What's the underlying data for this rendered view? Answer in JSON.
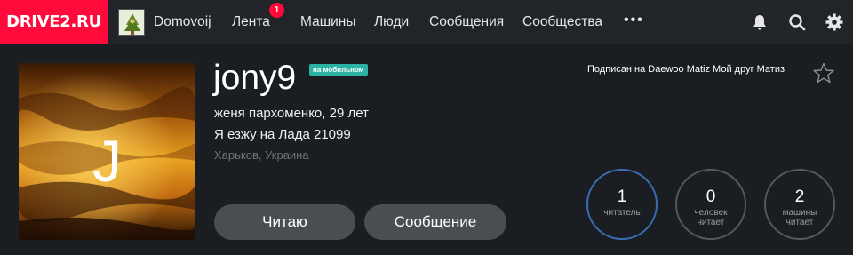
{
  "nav": {
    "logo": "DRIVE2.RU",
    "username": "Domovoij",
    "feed": "Лента",
    "feed_badge": "1",
    "cars": "Машины",
    "people": "Люди",
    "messages": "Сообщения",
    "communities": "Сообщества",
    "more": "•••",
    "icons": [
      "bell-icon",
      "search-icon",
      "gear-icon"
    ]
  },
  "profile": {
    "avatar_letter": "J",
    "username": "jony9",
    "mobile_badge": "на мобильном",
    "name_age": "женя пархоменко, 29 лет",
    "drives": "Я езжу на Лада 21099",
    "location": "Харьков, Украина",
    "subscribed": "Подписан на Daewoo Matiz Мой друг Матиз"
  },
  "buttons": {
    "follow": "Читаю",
    "message": "Сообщение"
  },
  "stats": [
    {
      "num": "1",
      "label": "читатель"
    },
    {
      "num": "0",
      "label_1": "человек",
      "label_2": "читает"
    },
    {
      "num": "2",
      "label_1": "машины",
      "label_2": "читает"
    }
  ],
  "colors": {
    "brand": "#ff0a3b",
    "background": "#1a1d21",
    "topbar": "#212429",
    "mobile_badge": "#2bb3a6",
    "active_ring": "#3a6db4"
  }
}
